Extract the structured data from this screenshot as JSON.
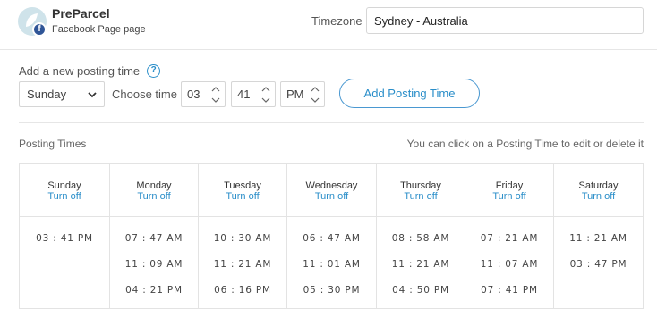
{
  "header": {
    "page_name": "PreParcel",
    "page_type": "Facebook Page page",
    "timezone_label": "Timezone",
    "timezone_value": "Sydney - Australia"
  },
  "add_section": {
    "title": "Add a new posting time",
    "day_value": "Sunday",
    "choose_time_label": "Choose time",
    "hour": "03",
    "minute": "41",
    "ampm": "PM",
    "add_button_label": "Add Posting Time"
  },
  "posting_times": {
    "title": "Posting Times",
    "hint": "You can click on a Posting Time to edit or delete it",
    "turn_off_label": "Turn off",
    "days": [
      {
        "name": "Sunday",
        "times": [
          "03 : 41 PM"
        ]
      },
      {
        "name": "Monday",
        "times": [
          "07 : 47 AM",
          "11 : 09 AM",
          "04 : 21 PM"
        ]
      },
      {
        "name": "Tuesday",
        "times": [
          "10 : 30 AM",
          "11 : 21 AM",
          "06 : 16 PM"
        ]
      },
      {
        "name": "Wednesday",
        "times": [
          "06 : 47 AM",
          "11 : 01 AM",
          "05 : 30 PM"
        ]
      },
      {
        "name": "Thursday",
        "times": [
          "08 : 58 AM",
          "11 : 21 AM",
          "04 : 50 PM"
        ]
      },
      {
        "name": "Friday",
        "times": [
          "07 : 21 AM",
          "11 : 07 AM",
          "07 : 41 PM"
        ]
      },
      {
        "name": "Saturday",
        "times": [
          "11 : 21 AM",
          "03 : 47 PM"
        ]
      }
    ]
  },
  "colors": {
    "accent": "#2a8ec9",
    "facebook": "#2f5597",
    "border": "#e3e3e3"
  },
  "icons": {
    "help": "question-circle-icon",
    "dropdown": "chevron-down-icon",
    "stepper": "up-down-arrows-icon"
  }
}
